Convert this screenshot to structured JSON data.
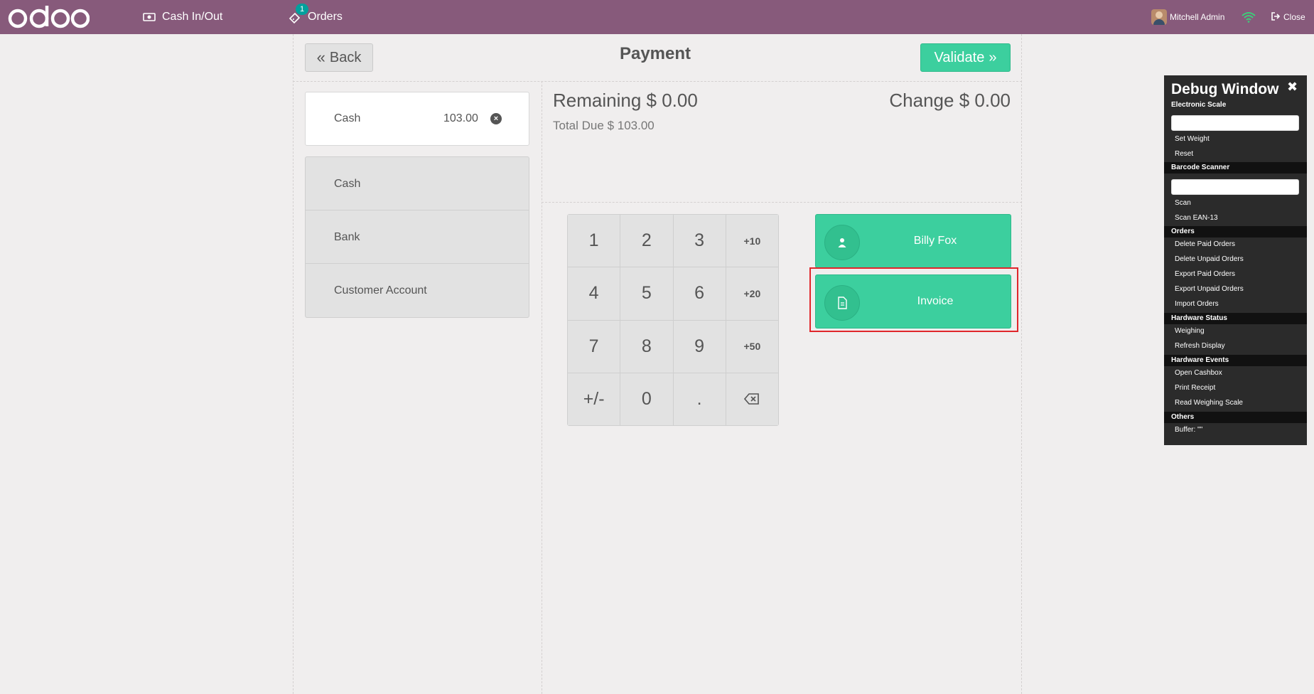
{
  "navbar": {
    "logo_text": "odoo",
    "cash_label": "Cash In/Out",
    "orders_label": "Orders",
    "orders_count": "1",
    "user_name": "Mitchell Admin",
    "close_label": "Close",
    "bg_color": "#875a7b"
  },
  "header": {
    "back_label": "Back",
    "title": "Payment",
    "validate_label": "Validate"
  },
  "paymentline": {
    "method": "Cash",
    "amount": "103.00"
  },
  "methods": [
    {
      "label": "Cash"
    },
    {
      "label": "Bank"
    },
    {
      "label": "Customer Account"
    }
  ],
  "summary": {
    "remaining_label": "Remaining",
    "remaining_value": "$ 0.00",
    "change_label": "Change",
    "change_value": "$ 0.00",
    "total_due_label": "Total Due",
    "total_due_value": "$ 103.00"
  },
  "numpad": [
    "1",
    "2",
    "3",
    "+10",
    "4",
    "5",
    "6",
    "+20",
    "7",
    "8",
    "9",
    "+50",
    "+/-",
    "0",
    "."
  ],
  "buttons": {
    "customer": "Billy Fox",
    "invoice": "Invoice",
    "accent_color": "#3ccf9e"
  },
  "debug": {
    "title": "Debug Window",
    "sec_scale": "Electronic Scale",
    "set_weight": "Set Weight",
    "reset": "Reset",
    "sec_barcode": "Barcode Scanner",
    "scan": "Scan",
    "scan_ean": "Scan EAN-13",
    "sec_orders": "Orders",
    "delete_paid": "Delete Paid Orders",
    "delete_unpaid": "Delete Unpaid Orders",
    "export_paid": "Export Paid Orders",
    "export_unpaid": "Export Unpaid Orders",
    "import_orders": "Import Orders",
    "sec_hw_status": "Hardware Status",
    "weighing": "Weighing",
    "refresh_display": "Refresh Display",
    "sec_hw_events": "Hardware Events",
    "open_cashbox": "Open Cashbox",
    "print_receipt": "Print Receipt",
    "read_scale": "Read Weighing Scale",
    "sec_others": "Others",
    "buffer": "Buffer: \"\""
  }
}
